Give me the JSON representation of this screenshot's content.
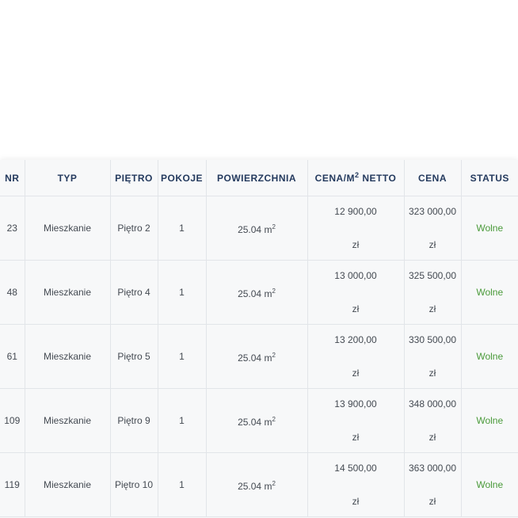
{
  "table": {
    "headers": {
      "nr": "NR",
      "typ": "TYP",
      "floor": "PIĘTRO",
      "rooms": "POKOJE",
      "area": "POWIERZCHNIA",
      "price_per_m2_prefix": "CENA/M",
      "price_per_m2_sup": "2",
      "price_per_m2_suffix": " NETTO",
      "price": "CENA",
      "status": "STATUS"
    },
    "area_unit": "m",
    "area_unit_sup": "2",
    "currency": "zł",
    "rows": [
      {
        "nr": "23",
        "typ": "Mieszkanie",
        "floor": "Piętro 2",
        "rooms": "1",
        "area": "25.04",
        "price_m2": "12 900,00",
        "price": "323 000,00",
        "status": "Wolne"
      },
      {
        "nr": "48",
        "typ": "Mieszkanie",
        "floor": "Piętro 4",
        "rooms": "1",
        "area": "25.04",
        "price_m2": "13 000,00",
        "price": "325 500,00",
        "status": "Wolne"
      },
      {
        "nr": "61",
        "typ": "Mieszkanie",
        "floor": "Piętro 5",
        "rooms": "1",
        "area": "25.04",
        "price_m2": "13 200,00",
        "price": "330 500,00",
        "status": "Wolne"
      },
      {
        "nr": "109",
        "typ": "Mieszkanie",
        "floor": "Piętro 9",
        "rooms": "1",
        "area": "25.04",
        "price_m2": "13 900,00",
        "price": "348 000,00",
        "status": "Wolne"
      },
      {
        "nr": "119",
        "typ": "Mieszkanie",
        "floor": "Piętro 10",
        "rooms": "1",
        "area": "25.04",
        "price_m2": "14 500,00",
        "price": "363 000,00",
        "status": "Wolne"
      }
    ]
  },
  "colors": {
    "header_text": "#243a5e",
    "status_free": "#4a9a3a",
    "table_bg": "#f7f8f9"
  }
}
